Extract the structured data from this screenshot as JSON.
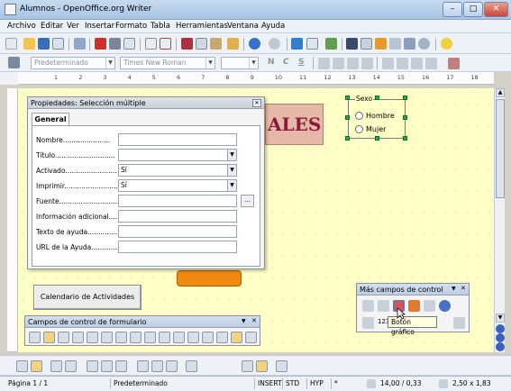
{
  "window": {
    "title": "Alumnos - OpenOffice.org Writer",
    "minimize": "–",
    "maximize": "□",
    "close": "✕"
  },
  "menu": [
    "Archivo",
    "Editar",
    "Ver",
    "Insertar",
    "Formato",
    "Tabla",
    "Herramientas",
    "Ventana",
    "Ayuda"
  ],
  "format_bar": {
    "style": "Predeterminado",
    "font": "Times New Roman",
    "size": "",
    "bold": "N",
    "italic": "C",
    "underline": "S"
  },
  "ruler": {
    "marks": [
      "1",
      "2",
      "3",
      "4",
      "5",
      "6",
      "7",
      "8",
      "9",
      "10",
      "11",
      "12",
      "13",
      "14",
      "15",
      "16",
      "17",
      "18"
    ]
  },
  "document": {
    "banner_text": "ALES",
    "group_box": {
      "label": "Sexo",
      "options": [
        "Hombre",
        "Mujer"
      ]
    },
    "button": {
      "label": "Calendario de Actividades"
    }
  },
  "props_dialog": {
    "title": "Propiedades: Selección múltiple",
    "close": "✕",
    "tab": "General",
    "fields": [
      {
        "label": "Nombre......................",
        "value": ""
      },
      {
        "label": "Título............................",
        "value": ""
      },
      {
        "label": "Activado........................",
        "value": "Sí"
      },
      {
        "label": "Imprimir.........................",
        "value": "Sí"
      },
      {
        "label": "Fuente...............................",
        "value": ""
      },
      {
        "label": "Información adicional......",
        "value": ""
      },
      {
        "label": "Texto de ayuda..............",
        "value": ""
      },
      {
        "label": "URL de la Ayuda..............",
        "value": ""
      }
    ],
    "browse": "..."
  },
  "form_controls_bar": {
    "title": "Campos de control de formulario"
  },
  "more_controls_bar": {
    "title": "Más campos de control",
    "tooltip": "Botón gráfico",
    "numeric_label": "123"
  },
  "status": {
    "page": "Página 1 / 1",
    "style": "Predeterminado",
    "insert": "INSERT",
    "std": "STD",
    "hyp": "HYP",
    "modified": "*",
    "position": "14,00 / 0,33",
    "size": "2,50 x 1,83"
  },
  "colors": {
    "doc_bg": "#ffffc8",
    "banner": "#8a1a3a",
    "accent": "#f08a10"
  }
}
